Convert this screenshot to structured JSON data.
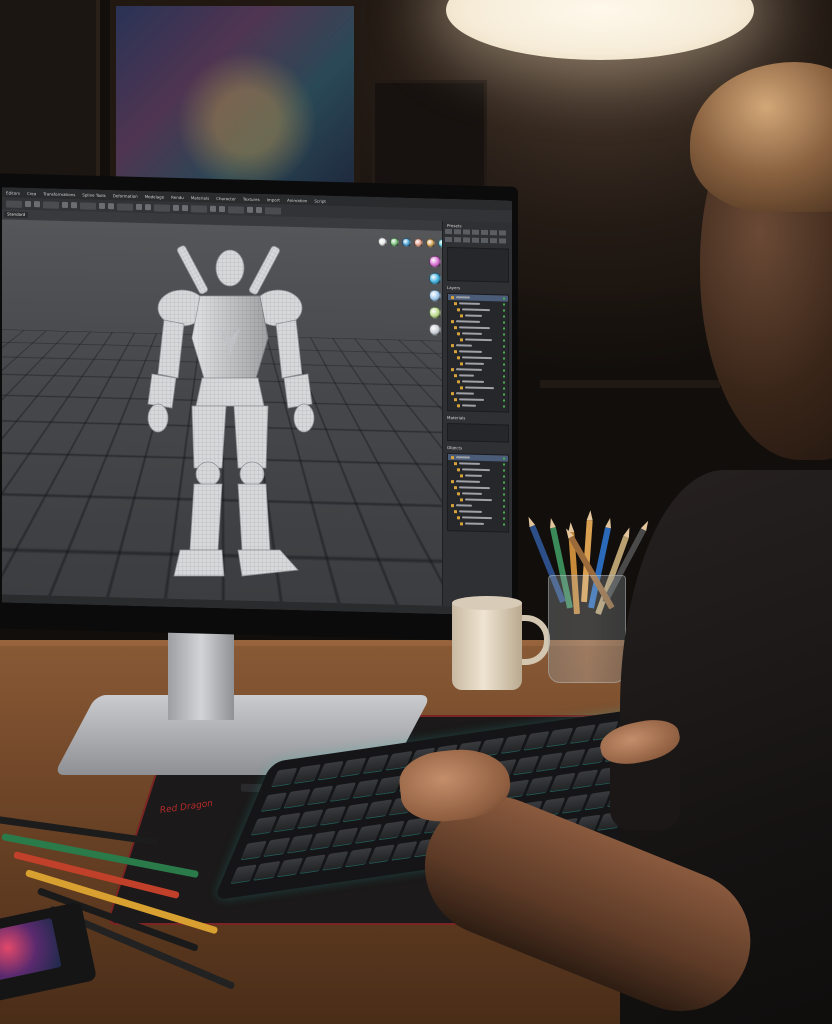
{
  "scene": {
    "description_colors": {
      "lamp_glow": "#fff9ec",
      "desk_wood": "#8a5a36",
      "mat_border": "#7a2424",
      "keyboard_backlight": "#3cdcc8"
    }
  },
  "app": {
    "menu": [
      "Editors",
      "Crea",
      "Transformations",
      "Spline Tools",
      "Deformation",
      "Modelage",
      "Rendu",
      "Materials",
      "Character",
      "Textures",
      "Import",
      "Animation",
      "Script"
    ],
    "mode": "Standard",
    "status": "",
    "panel": {
      "top_label": "Presets",
      "tabs_count": 14,
      "section_1": "Layers",
      "section_2": "Materials",
      "section_3": "Objects"
    },
    "material_balls": [
      "#e8e8e8",
      "#7bc47f",
      "#4aa3d8",
      "#e7a08a",
      "#d9a95a",
      "#5ac8d6",
      "#a7e06a"
    ],
    "material_column": [
      "#d86bd3",
      "#3fb0e0",
      "#9ec8ee",
      "#b9d98a",
      "#c9cfd6"
    ]
  },
  "mat": {
    "brand": "Red Dragon"
  }
}
